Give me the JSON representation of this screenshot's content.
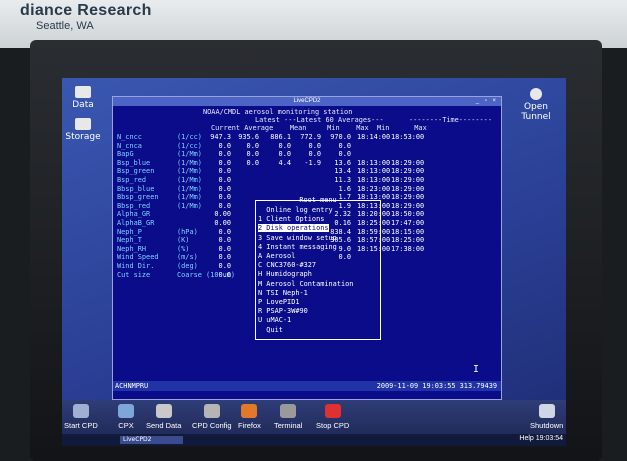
{
  "sign": {
    "line1": "diance Research",
    "line2": "Seattle, WA"
  },
  "desktop_icons": [
    {
      "label": "Data"
    },
    {
      "label": "Storage"
    },
    {
      "label": "Open Tunnel"
    }
  ],
  "window": {
    "title": "LiveCPD2"
  },
  "terminal": {
    "heading": "NOAA/CMDL aerosol monitoring station",
    "subheading": "Latest ---Latest 60 Averages---",
    "time_heading": "--------Time--------",
    "columns": "Current Average    Mean     Min    Max  Min      Max",
    "rows": [
      {
        "name": "N_cncc",
        "unit": "(1/cc)",
        "cur": "947.3",
        "avg": "935.6",
        "mean": "886.1",
        "min": "772.9",
        "max": "970.0",
        "t1": "18:14:00",
        "t2": "18:53:00"
      },
      {
        "name": "N_cnca",
        "unit": "(1/cc)",
        "cur": "0.0",
        "avg": "0.0",
        "mean": "0.0",
        "min": "0.0",
        "max": "0.0",
        "t1": "",
        "t2": ""
      },
      {
        "name": "BapG",
        "unit": "(1/Mm)",
        "cur": "0.0",
        "avg": "0.0",
        "mean": "0.0",
        "min": "0.0",
        "max": "0.0",
        "t1": "",
        "t2": ""
      },
      {
        "name": "Bsp_blue",
        "unit": "(1/Mm)",
        "cur": "0.0",
        "avg": "0.0",
        "mean": "4.4",
        "min": "-1.9",
        "max": "13.6",
        "t1": "18:13:00",
        "t2": "18:29:00"
      },
      {
        "name": "Bsp_green",
        "unit": "(1/Mm)",
        "cur": "0.0",
        "avg": "",
        "mean": "",
        "min": "",
        "max": "13.4",
        "t1": "18:13:00",
        "t2": "18:29:00"
      },
      {
        "name": "Bsp_red",
        "unit": "(1/Mm)",
        "cur": "0.0",
        "avg": "",
        "mean": "",
        "min": "",
        "max": "11.3",
        "t1": "18:13:00",
        "t2": "18:29:00"
      },
      {
        "name": "Bbsp_blue",
        "unit": "(1/Mm)",
        "cur": "0.0",
        "avg": "",
        "mean": "",
        "min": "",
        "max": "1.6",
        "t1": "18:23:00",
        "t2": "18:29:00"
      },
      {
        "name": "Bbsp_green",
        "unit": "(1/Mm)",
        "cur": "0.0",
        "avg": "",
        "mean": "",
        "min": "",
        "max": "1.7",
        "t1": "18:13:00",
        "t2": "18:29:00"
      },
      {
        "name": "Bbsp_red",
        "unit": "(1/Mm)",
        "cur": "0.0",
        "avg": "",
        "mean": "",
        "min": "",
        "max": "1.9",
        "t1": "18:13:00",
        "t2": "18:29:00"
      },
      {
        "name": "Alpha_GR",
        "unit": "",
        "cur": "0.00",
        "avg": "",
        "mean": "",
        "min": "",
        "max": "2.32",
        "t1": "18:20:00",
        "t2": "18:50:00"
      },
      {
        "name": "AlphaB_GR",
        "unit": "",
        "cur": "0.00",
        "avg": "",
        "mean": "",
        "min": "",
        "max": "0.16",
        "t1": "18:25:00",
        "t2": "17:47:00"
      },
      {
        "name": "Neph_P",
        "unit": "(hPa)",
        "cur": "0.0",
        "avg": "",
        "mean": "",
        "min": "",
        "max": "838.4",
        "t1": "18:59:00",
        "t2": "18:15:00"
      },
      {
        "name": "Neph_T",
        "unit": "(K)",
        "cur": "0.0",
        "avg": "",
        "mean": "",
        "min": "",
        "max": "305.6",
        "t1": "18:57:00",
        "t2": "18:25:00"
      },
      {
        "name": "Neph_RH",
        "unit": "(%)",
        "cur": "0.0",
        "avg": "",
        "mean": "",
        "min": "",
        "max": "9.0",
        "t1": "18:15:00",
        "t2": "17:38:00"
      },
      {
        "name": "Wind Speed",
        "unit": "(m/s)",
        "cur": "0.0",
        "avg": "",
        "mean": "",
        "min": "",
        "max": "0.0",
        "t1": "",
        "t2": ""
      },
      {
        "name": "Wind Dir.",
        "unit": "(deg)",
        "cur": "0.0",
        "avg": "",
        "mean": "",
        "min": "",
        "max": "",
        "t1": "",
        "t2": ""
      },
      {
        "name": "Cut size",
        "unit": "Coarse (10 um)",
        "cur": "0.0",
        "avg": "",
        "mean": "",
        "min": "",
        "max": "",
        "t1": "",
        "t2": ""
      }
    ],
    "menu": {
      "title": "Root menu",
      "items": [
        {
          "key": "",
          "label": "Online log entry",
          "selected": false
        },
        {
          "key": "1",
          "label": "Client Options",
          "selected": false
        },
        {
          "key": "2",
          "label": "Disk operations",
          "selected": true
        },
        {
          "key": "3",
          "label": "Save window setup",
          "selected": false
        },
        {
          "key": "4",
          "label": "Instant messaging",
          "selected": false
        },
        {
          "key": "A",
          "label": "Aerosol",
          "selected": false
        },
        {
          "key": "C",
          "label": "CNC3760-#327",
          "selected": false
        },
        {
          "key": "H",
          "label": "Humidograph",
          "selected": false
        },
        {
          "key": "M",
          "label": "Aerosol Contamination",
          "selected": false
        },
        {
          "key": "N",
          "label": "TSI Neph-1",
          "selected": false
        },
        {
          "key": "P",
          "label": "LovePID1",
          "selected": false
        },
        {
          "key": "R",
          "label": "PSAP-3W#90",
          "selected": false
        },
        {
          "key": "U",
          "label": "uMAC-1",
          "selected": false
        },
        {
          "key": "",
          "label": "Quit",
          "selected": false
        }
      ]
    },
    "status_left": "ACHNMPRU",
    "status_right": "2009-11-09 19:03:55 313.79439",
    "cursor_glyph": "I"
  },
  "taskbar": {
    "items": [
      {
        "label": "Start CPD",
        "color": "#9fb0d0"
      },
      {
        "label": "CPX",
        "color": "#7fa6d8"
      },
      {
        "label": "Send Data",
        "color": "#c9c9c9"
      },
      {
        "label": "CPD Config",
        "color": "#b5b5b5"
      },
      {
        "label": "Firefox",
        "color": "#e07a2a"
      },
      {
        "label": "Terminal",
        "color": "#9a9a9a"
      },
      {
        "label": "Stop CPD",
        "color": "#e03030"
      }
    ],
    "shutdown_label": "Shutdown",
    "task_label": "LiveCPD2",
    "clock": "Help 19:03:54"
  }
}
